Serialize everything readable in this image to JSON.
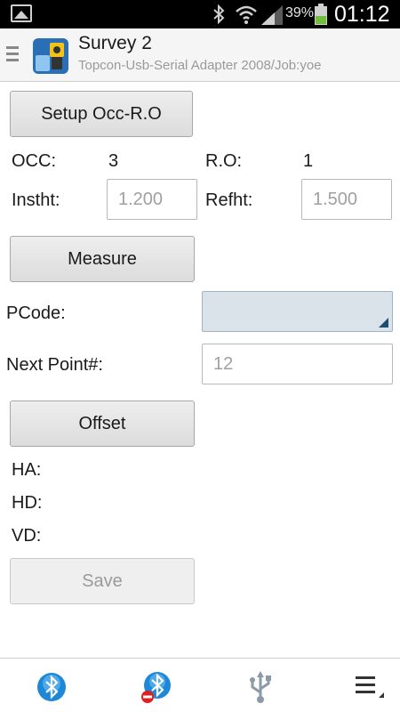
{
  "status_bar": {
    "battery_percent": "39%",
    "time": "01:12"
  },
  "action_bar": {
    "title": "Survey 2",
    "subtitle": "Topcon-Usb-Serial Adapter 2008/Job:yoe"
  },
  "form": {
    "setup_button": "Setup Occ-R.O",
    "occ_label": "OCC:",
    "occ_value": "3",
    "ro_label": "R.O:",
    "ro_value": "1",
    "instht_label": "Instht:",
    "instht_placeholder": "1.200",
    "refht_label": "Refht:",
    "refht_placeholder": "1.500",
    "measure_button": "Measure",
    "pcode_label": "PCode:",
    "pcode_value": "",
    "next_point_label": "Next Point#:",
    "next_point_placeholder": "12",
    "offset_button": "Offset",
    "ha_label": "HA:",
    "hd_label": "HD:",
    "vd_label": "VD:",
    "save_button": "Save"
  },
  "bottom_bar": {
    "icons": [
      "bluetooth-icon",
      "bluetooth-disconnect-icon",
      "usb-icon",
      "overflow-menu-icon"
    ]
  },
  "colors": {
    "status_bar_bg": "#000000",
    "action_bar_bg": "#f5f5f5",
    "dropdown_bg": "#dbe3ea",
    "bluetooth_blue": "#1e88d8",
    "disconnect_red": "#e02020"
  }
}
